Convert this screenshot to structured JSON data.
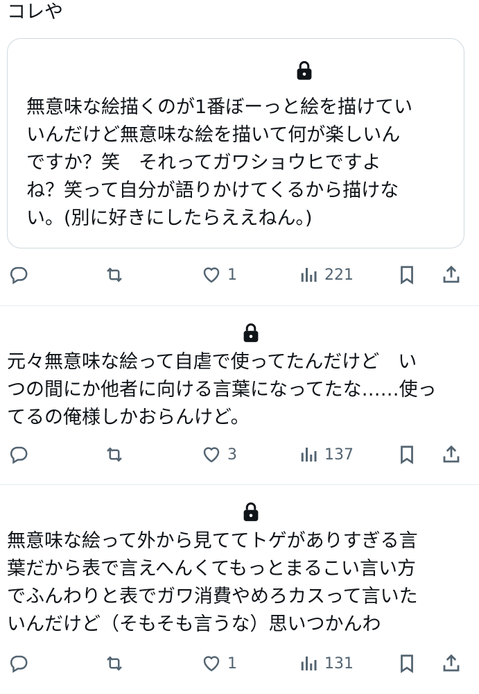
{
  "intro_text": "コレや",
  "quoted_post": {
    "text": "無意味な絵描くのが1番ぼーっと絵を描けてい\nいんだけど無意味な絵を描いて何が楽しいん\nですか？笑　それってガワショウヒですよ\nね？笑って自分が語りかけてくるから描けな\nい。(別に好きにしたらええねん。)"
  },
  "posts": [
    {
      "text": "元々無意味な絵って自虐で使ってたんだけど　い\nつの間にか他者に向ける言葉になってたな……使っ\nてるの俺様しかおらんけど。"
    },
    {
      "text": "無意味な絵って外から見ててトゲがありすぎる言\n葉だから表で言えへんくてもっとまるこい言い方\nでふんわりと表でガワ消費やめろカスって言いた\nいんだけど（そもそも言うな）思いつかんわ"
    }
  ],
  "action_bars": [
    {
      "likes": "1",
      "views": "221"
    },
    {
      "likes": "3",
      "views": "137"
    },
    {
      "likes": "1",
      "views": "131"
    }
  ],
  "colors": {
    "icon": "#536471",
    "text": "#0f1419",
    "border": "#cfd9de"
  }
}
